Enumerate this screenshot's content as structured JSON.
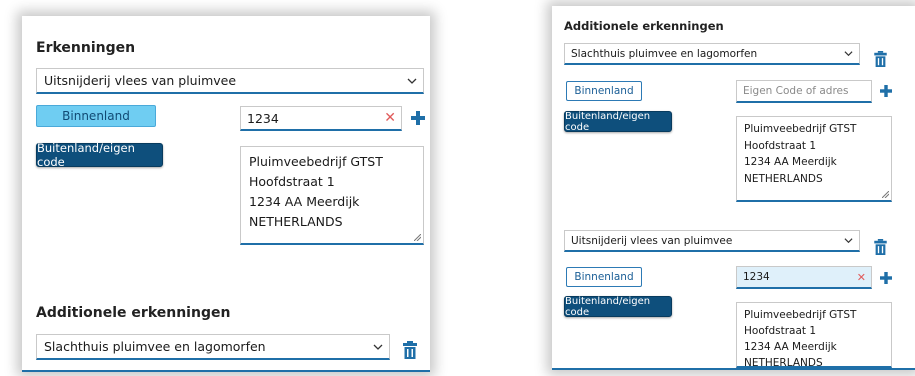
{
  "left": {
    "heading": "Erkenningen",
    "select": "Uitsnijderij vlees van pluimvee",
    "btn_domestic": "Binnenland",
    "btn_foreign": "Buitenland/eigen code",
    "code_value": "1234",
    "address": [
      "Pluimveebedrijf GTST",
      "Hoofdstraat 1",
      "1234 AA Meerdijk",
      "NETHERLANDS"
    ],
    "additional_heading": "Additionele erkenningen",
    "additional_select": "Slachthuis pluimvee en lagomorfen"
  },
  "right": {
    "heading": "Additionele erkenningen",
    "block1": {
      "select": "Slachthuis pluimvee en lagomorfen",
      "btn_domestic": "Binnenland",
      "btn_foreign": "Buitenland/eigen code",
      "code_placeholder": "Eigen Code of adres",
      "address": [
        "Pluimveebedrijf GTST",
        "Hoofdstraat 1",
        "1234 AA Meerdijk",
        "NETHERLANDS"
      ]
    },
    "block2": {
      "select": "Uitsnijderij vlees van pluimvee",
      "btn_domestic": "Binnenland",
      "btn_foreign": "Buitenland/eigen code",
      "code_value": "1234",
      "address": [
        "Pluimveebedrijf GTST",
        "Hoofdstraat 1",
        "1234 AA Meerdijk",
        "NETHERLANDS"
      ]
    }
  },
  "icons": {
    "chevron": "chevron-down-icon",
    "plus": "plus-icon",
    "trash": "trash-icon",
    "clear": "close-icon"
  },
  "colors": {
    "accent": "#1f6fa8",
    "active_button": "#6fcdf2",
    "dark_button": "#0e4f7c",
    "clear_icon": "#e05a5a"
  }
}
